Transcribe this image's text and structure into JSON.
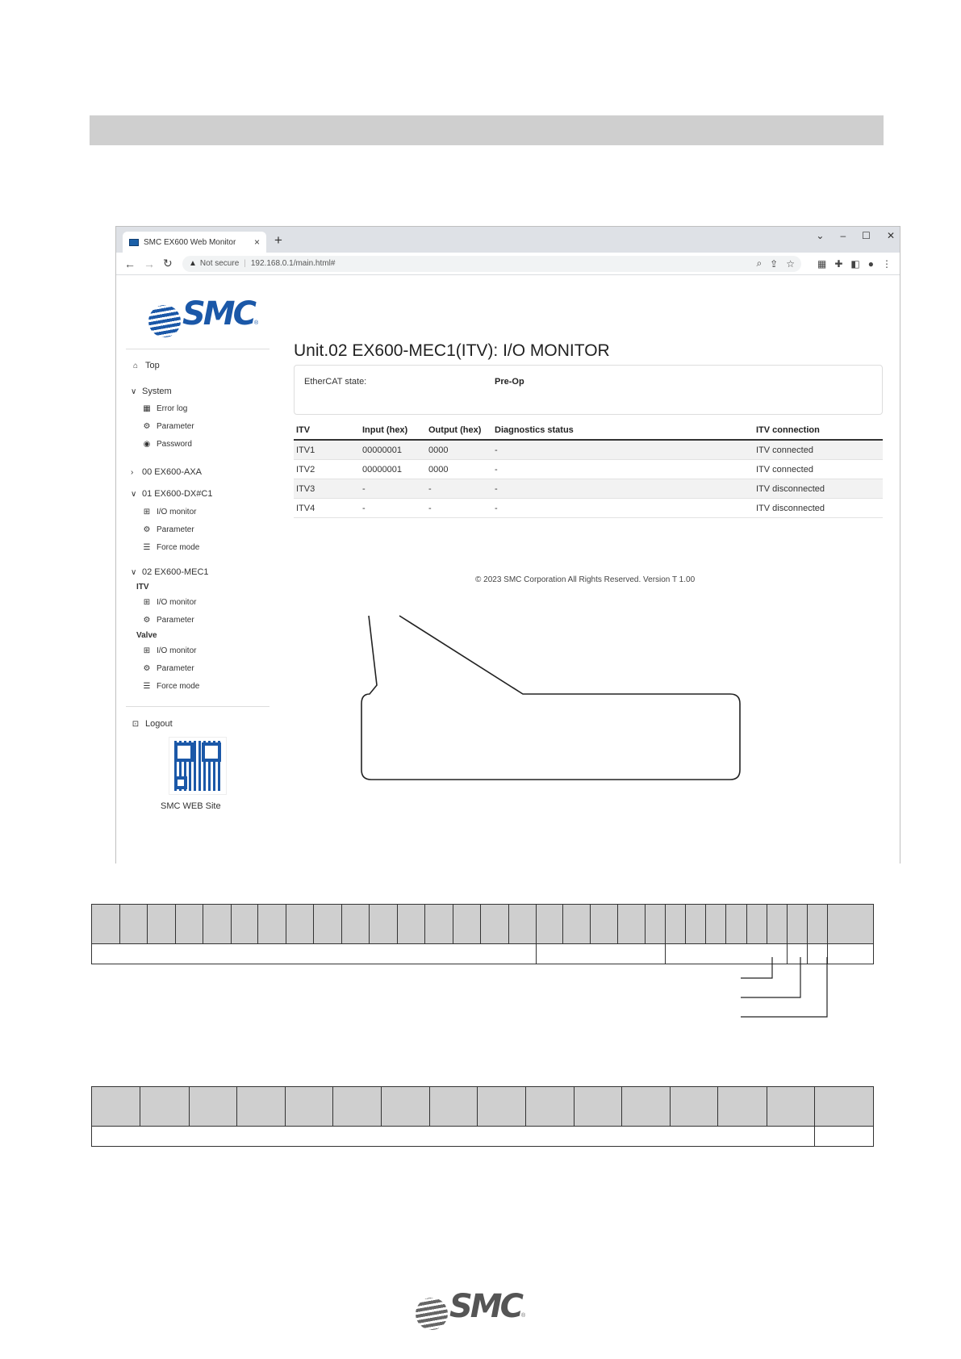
{
  "browser": {
    "tab_title": "SMC EX600 Web Monitor",
    "tab_close": "×",
    "new_tab": "+",
    "window_controls": [
      "⌄",
      "–",
      "☐",
      "✕"
    ],
    "security_label": "Not secure",
    "url": "192.168.0.1/main.html#"
  },
  "sidebar": {
    "logo": "SMC",
    "top": "Top",
    "system": "System",
    "error_log": "Error log",
    "parameter": "Parameter",
    "password": "Password",
    "unit00": "00 EX600-AXA",
    "unit01": "01 EX600-DX#C1",
    "unit01_items": [
      "I/O monitor",
      "Parameter",
      "Force mode"
    ],
    "unit02": "02 EX600-MEC1",
    "itv_group": "ITV",
    "itv_items": [
      "I/O monitor",
      "Parameter"
    ],
    "valve_group": "Valve",
    "valve_items": [
      "I/O monitor",
      "Parameter",
      "Force mode"
    ],
    "logout": "Logout",
    "qr_label": "SMC WEB Site"
  },
  "main": {
    "title": "Unit.02 EX600-MEC1(ITV): I/O MONITOR",
    "ethercat_label": "EtherCAT state:",
    "ethercat_value": "Pre-Op",
    "columns": [
      "ITV",
      "Input (hex)",
      "Output (hex)",
      "Diagnostics status",
      "ITV connection"
    ],
    "rows": [
      {
        "itv": "ITV1",
        "input": "00000001",
        "output": "0000",
        "diag": "-",
        "connection": "ITV connected"
      },
      {
        "itv": "ITV2",
        "input": "00000001",
        "output": "0000",
        "diag": "-",
        "connection": "ITV connected"
      },
      {
        "itv": "ITV3",
        "input": "-",
        "output": "-",
        "diag": "-",
        "connection": "ITV disconnected"
      },
      {
        "itv": "ITV4",
        "input": "-",
        "output": "-",
        "diag": "-",
        "connection": "ITV disconnected"
      }
    ],
    "copyright": "© 2023 SMC Corporation All Rights Reserved. Version T 1.00"
  },
  "colors": {
    "brand_blue": "#1b58a8",
    "connected_green": "#2e7d32",
    "header_gray": "#cfcfcf"
  },
  "footer_logo": "SMC"
}
